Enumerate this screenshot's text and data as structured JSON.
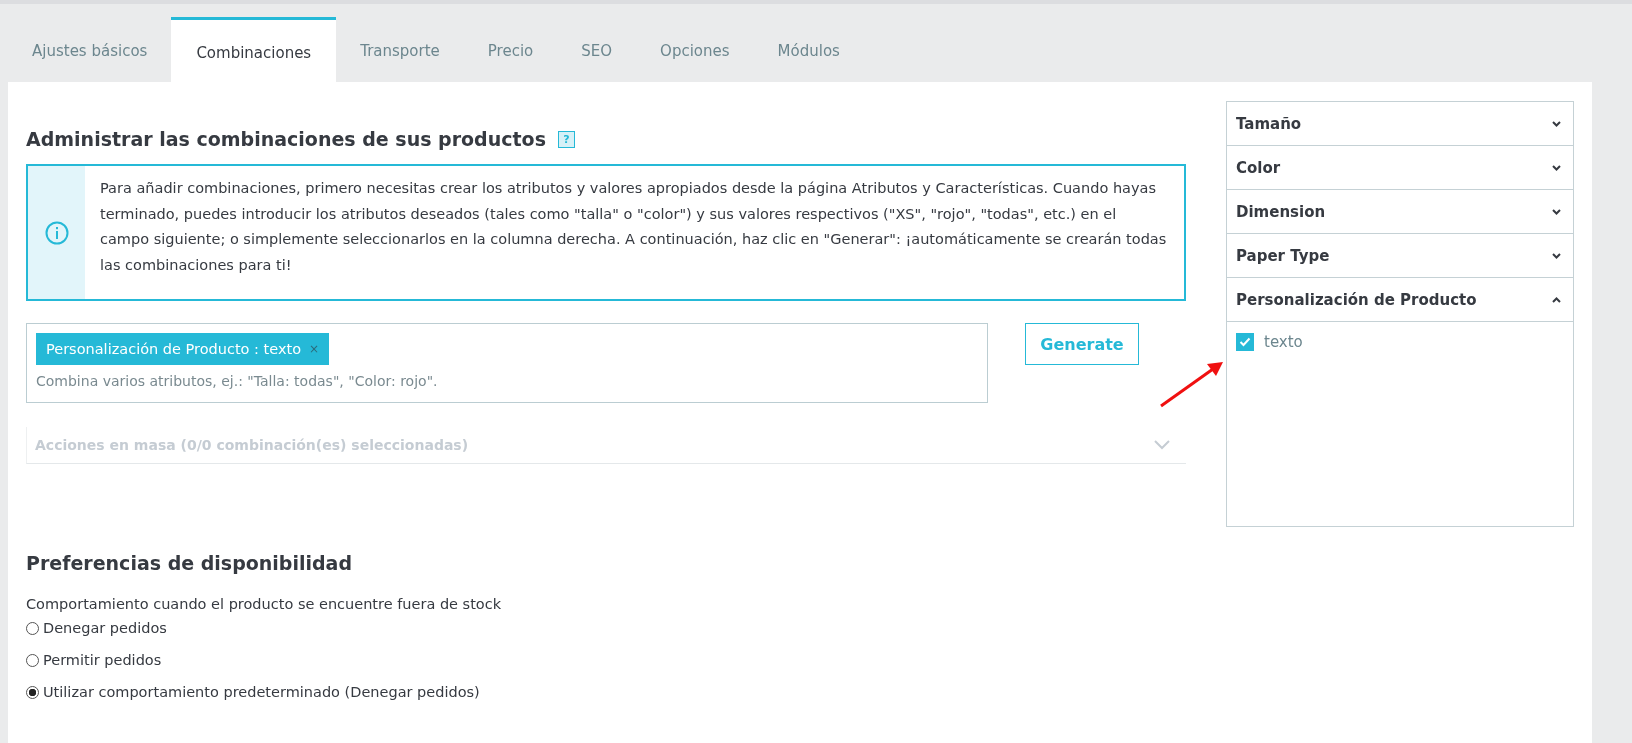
{
  "tabs": [
    {
      "label": "Ajustes básicos",
      "selected": false
    },
    {
      "label": "Combinaciones",
      "selected": true
    },
    {
      "label": "Transporte",
      "selected": false
    },
    {
      "label": "Precio",
      "selected": false
    },
    {
      "label": "SEO",
      "selected": false
    },
    {
      "label": "Opciones",
      "selected": false
    },
    {
      "label": "Módulos",
      "selected": false
    }
  ],
  "combinations": {
    "title": "Administrar las combinaciones de sus productos",
    "help_icon": "?",
    "info": "Para añadir combinaciones, primero necesitas crear los atributos y valores apropiados desde la página Atributos y Características. Cuando hayas terminado, puedes introducir los atributos deseados (tales como \"talla\" o \"color\") y sus valores respectivos (\"XS\", \"rojo\", \"todas\", etc.) en el campo siguiente; o simplemente seleccionarlos en la columna derecha. A continuación, haz clic en \"Generar\": ¡automáticamente se crearán todas las combinaciones para ti!",
    "tags": [
      {
        "label": "Personalización de Producto : texto",
        "remove": "×"
      }
    ],
    "placeholder": "Combina varios atributos, ej.: \"Talla: todas\", \"Color: rojo\".",
    "generate_button": "Generate",
    "bulk_actions": {
      "label": "Acciones en masa (0/0 combinación(es) seleccionadas)",
      "disabled": true,
      "expanded": false
    }
  },
  "attributes": [
    {
      "name": "Tamaño",
      "expanded": false
    },
    {
      "name": "Color",
      "expanded": false
    },
    {
      "name": "Dimension",
      "expanded": false
    },
    {
      "name": "Paper Type",
      "expanded": false
    },
    {
      "name": "Personalización de Producto",
      "expanded": true,
      "values": [
        {
          "label": "texto",
          "checked": true
        }
      ]
    }
  ],
  "availability": {
    "title": "Preferencias de disponibilidad",
    "label": "Comportamiento cuando el producto se encuentre fuera de stock",
    "options": [
      {
        "label": "Denegar pedidos",
        "selected": false
      },
      {
        "label": "Permitir pedidos",
        "selected": false
      },
      {
        "label": "Utilizar comportamiento predeterminado (Denegar pedidos)",
        "selected": true
      }
    ]
  }
}
